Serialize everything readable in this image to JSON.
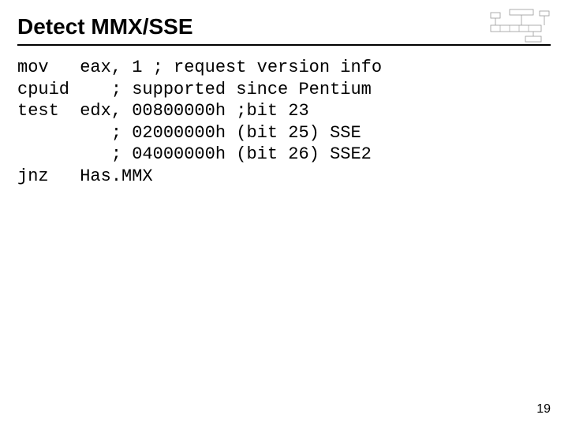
{
  "title": "Detect MMX/SSE",
  "code": {
    "l1": "mov   eax, 1 ; request version info",
    "l2": "cpuid    ; supported since Pentium",
    "l3": "test  edx, 00800000h ;bit 23",
    "l4": "         ; 02000000h (bit 25) SSE",
    "l5": "         ; 04000000h (bit 26) SSE2",
    "l6": "jnz   Has.MMX"
  },
  "page_number": "19"
}
